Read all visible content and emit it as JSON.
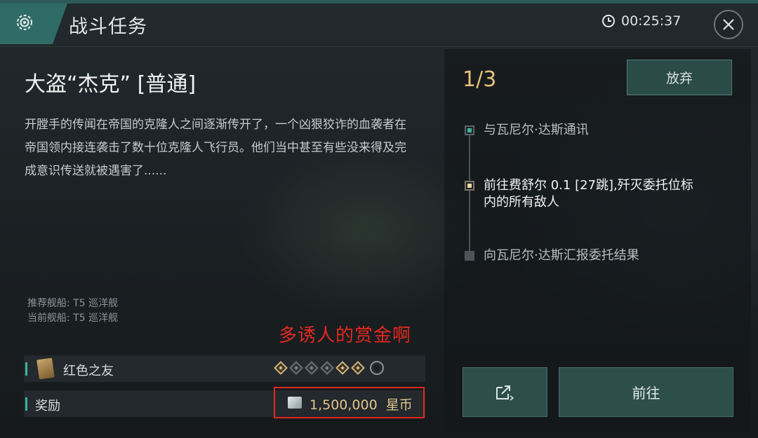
{
  "header": {
    "title": "战斗任务",
    "timer": "00:25:37",
    "icons": {
      "badge": "gear-icon",
      "clock": "clock-icon",
      "close": "close-icon"
    }
  },
  "mission": {
    "title": "大盗“杰克” [普通]",
    "description": "开膛手的传闻在帝国的克隆人之间逐渐传开了，一个凶狠狡诈的血袭者在帝国领内接连袭击了数十位克隆人飞行员。他们当中甚至有些没来得及完成意识传送就被遇害了......",
    "recommended_ship": "推荐舰船: T5 巡洋舰",
    "current_ship": "当前舰船: T5 巡洋舰"
  },
  "annotation": "多诱人的赏金啊",
  "faction": {
    "name": "红色之友",
    "standing": [
      "on",
      "off",
      "off",
      "off",
      "on",
      "on",
      "ring"
    ]
  },
  "reward": {
    "label": "奖励",
    "amount": "1,500,000",
    "currency": "星币"
  },
  "objectives": {
    "progress": "1/3",
    "abandon_label": "放弃",
    "steps": [
      {
        "text": "与瓦尼尔·达斯通讯",
        "state": "done"
      },
      {
        "text": "前往费舒尔 0.1 [27跳],歼灭委托位标内的所有敌人",
        "state": "current"
      },
      {
        "text": "向瓦尼尔·达斯汇报委托结果",
        "state": "pending"
      }
    ]
  },
  "actions": {
    "share_icon": "share-icon",
    "go_label": "前往"
  },
  "colors": {
    "accent": "#3fb39d",
    "progress": "#e7c079",
    "annotation": "#e3281f",
    "button_bg": "#2d4f4b"
  }
}
